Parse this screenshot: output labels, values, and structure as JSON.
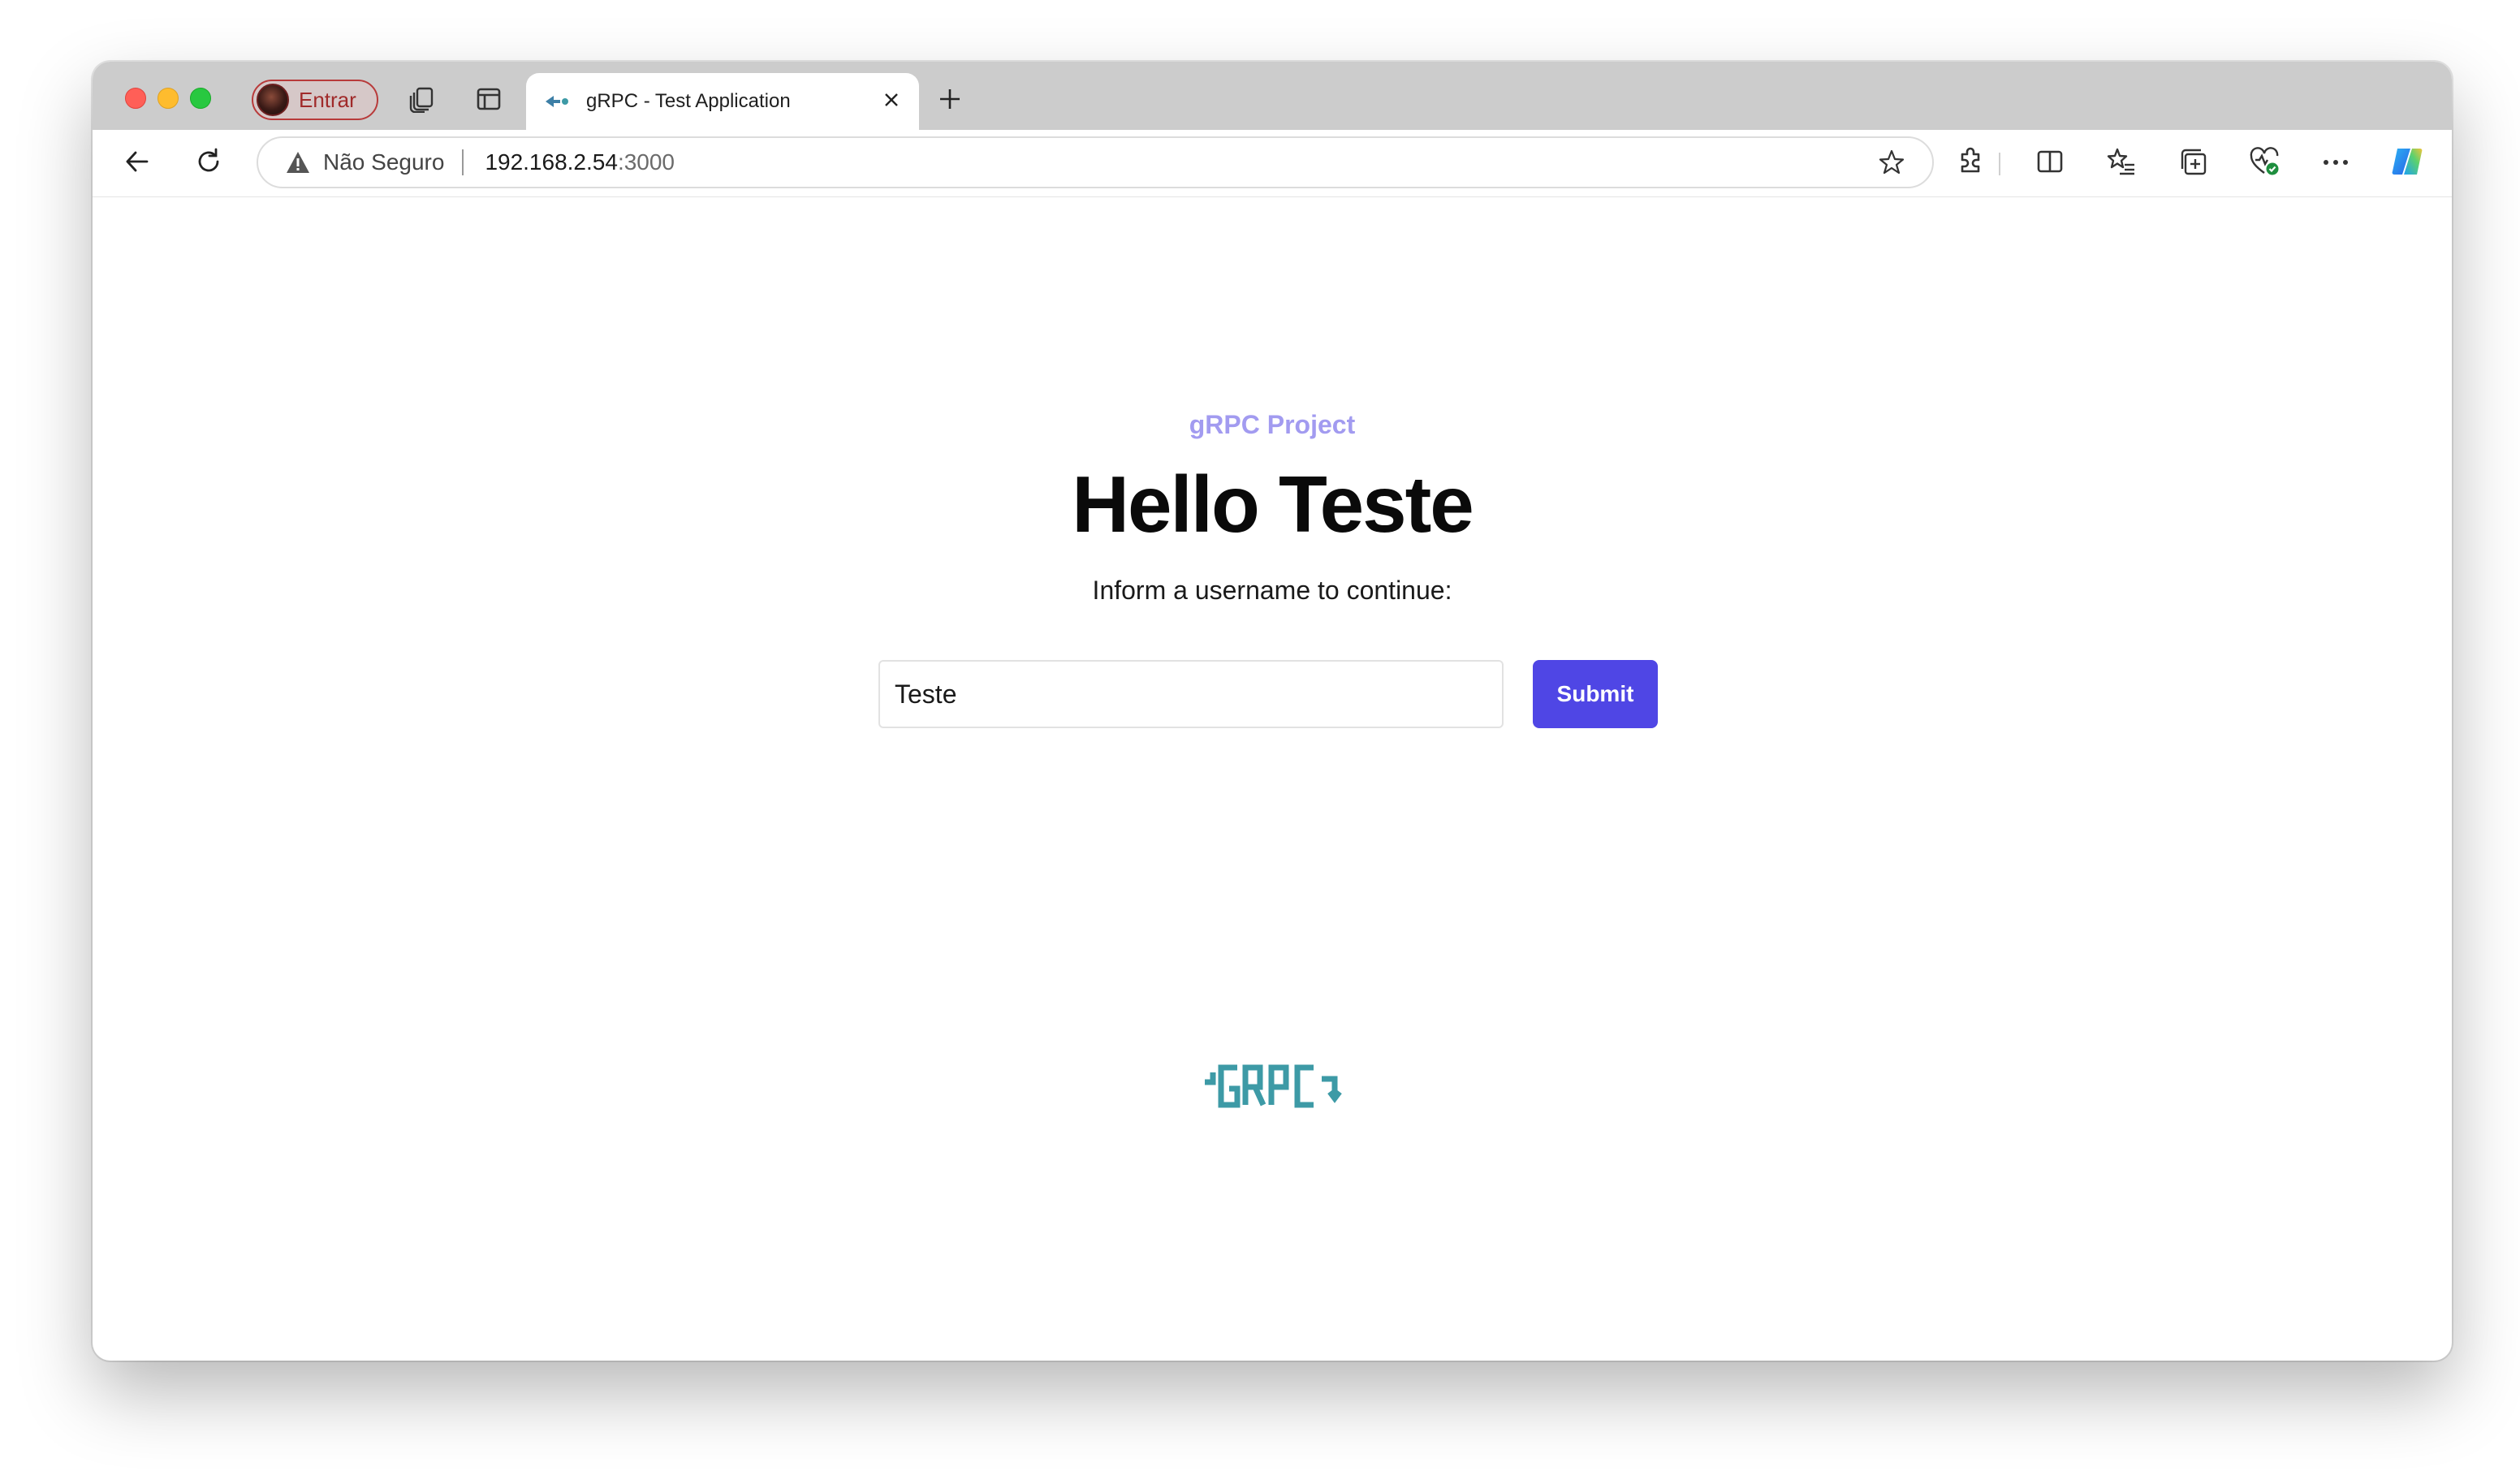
{
  "browser": {
    "profile_label": "Entrar",
    "tab_title": "gRPC - Test Application",
    "address": {
      "security_label": "Não Seguro",
      "host": "192.168.2.54",
      "port": ":3000"
    },
    "icons": {
      "back": "back-arrow-icon",
      "reload": "reload-icon",
      "warning": "warning-icon",
      "favorite": "star-icon",
      "extensions": "extensions-icon",
      "split_screen": "split-screen-icon",
      "favorites": "favorites-icon",
      "collections": "collections-icon",
      "browser_essentials": "browser-essentials-icon",
      "more": "more-icon",
      "copilot": "copilot-icon"
    }
  },
  "page": {
    "eyebrow": "gRPC Project",
    "heading": "Hello Teste",
    "subtitle": "Inform a username to continue:",
    "username_value": "Teste",
    "submit_label": "Submit",
    "logo_text": "GRPC"
  },
  "colors": {
    "accent": "#4f46e5",
    "eyebrow": "#a29bf0",
    "logo": "#3d9aa6"
  }
}
